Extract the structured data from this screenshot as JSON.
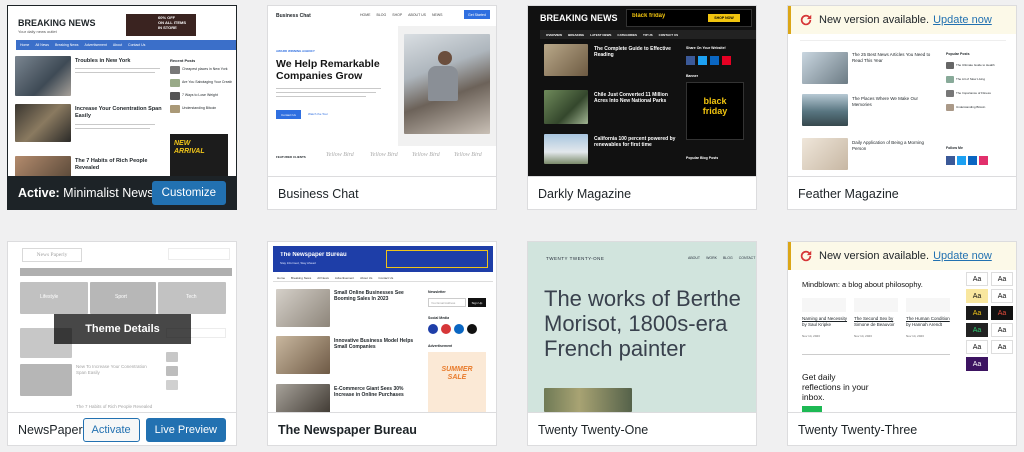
{
  "themes": [
    {
      "name": "Minimalist Newspaper",
      "active_prefix": "Active:",
      "customize_label": "Customize",
      "preview": {
        "site_title": "BREAKING NEWS",
        "tagline": "Your daily news outlet",
        "promo": "60% OFF\nON ALL ITEMS\nIN STORE",
        "nav": [
          "Home",
          "All News",
          "Breaking News",
          "Advertisement",
          "About",
          "Contact Us"
        ],
        "posts": [
          "Troubles in New York",
          "Increase Your Conentration Span Easily",
          "The 7 Habits of Rich People Revealed"
        ],
        "sidebar_title": "Recent Posts",
        "sidebar_items": [
          "Cheapest places in New York",
          "Are You Sabotaging Your Creativity?",
          "7 Ways to Lose Weight",
          "Understanding Bitcoin"
        ],
        "banner": "NEW ARRIVAL"
      }
    },
    {
      "name": "Business Chat",
      "preview": {
        "site_title": "Business Chat",
        "nav": [
          "HOME",
          "BLOG",
          "SHOP",
          "ABOUT US",
          "NEWS"
        ],
        "cta": "Get Started",
        "eyebrow": "AWARD WINNING AGENCY",
        "headline": "We Help Remarkable Companies Grow",
        "btn1": "Contact Us",
        "btn2": "Watch the Tour",
        "clients_label": "FEATURED CLIENTS",
        "clients": [
          "Yellow Bird",
          "Yellow Bird",
          "Yellow Bird",
          "Yellow Bird"
        ]
      }
    },
    {
      "name": "Darkly Magazine",
      "preview": {
        "site_title": "BREAKING NEWS",
        "promo": "black friday",
        "shop": "SHOP NOW",
        "nav": [
          "OVERVIEW",
          "BREAKING",
          "LATEST NEWS",
          "CATEGORIES",
          "TIP US",
          "CONTACT US"
        ],
        "posts": [
          "The Complete Guide to Effective Reading",
          "Chile Just Converted 11 Million Acres Into New National Parks",
          "California 100 percent powered by renewables for first time"
        ],
        "share_title": "Share On Your Website!",
        "banner_title": "Banner",
        "banner": "black friday",
        "popular_title": "Popular Blog Posts"
      }
    },
    {
      "name": "Feather Magazine",
      "notice": "New version available.",
      "update_link": "Update now",
      "preview": {
        "posts": [
          "The 25 Best News Articles You Need to Read This Year",
          "The Places Where We Make Our Memories",
          "Daily Application of Being a Morning Person"
        ],
        "popular_title": "Popular Posts",
        "popular": [
          "The Ultimate Guide to Health",
          "The Art of Slow Living",
          "The Importance of Fitness",
          "Understanding Bitcoin"
        ],
        "follow_title": "Follow Me"
      }
    },
    {
      "name": "NewsPaperly",
      "details_label": "Theme Details",
      "activate_label": "Activate",
      "live_preview_label": "Live Preview",
      "preview": {
        "logo": "News Paperly",
        "categories": [
          "Lifestyle",
          "Sport",
          "Tech"
        ],
        "post": "New To Increase Your Conentration Span Easily",
        "post2": "The 7 Habits of Rich People Revealed"
      }
    },
    {
      "name": "The Newspaper Bureau",
      "preview": {
        "site_title": "The Newspaper Bureau",
        "tagline": "Stay Informed, Stay Ahead",
        "nav": [
          "Home",
          "Breaking News",
          "All News",
          "Advertisement",
          "About Us",
          "Contact Us"
        ],
        "posts": [
          "Small Online Businesses See Booming Sales In 2023",
          "Innovative Business Model Helps Small Companies",
          "E-Commerce Giant Sees 30% Increase in Online Purchases"
        ],
        "newsletter": "Newsletter",
        "email_placeholder": "Your Email Address",
        "signup": "Sign Up",
        "social": "Social Media",
        "ad": "Advertisement",
        "sale": "SUMMER SALE"
      }
    },
    {
      "name": "Twenty Twenty-One",
      "preview": {
        "site_title": "TWENTY TWENTY-ONE",
        "nav": [
          "ABOUT",
          "WORK",
          "BLOG",
          "CONTACT"
        ],
        "headline": "The works of Berthe Morisot, 1800s-era French painter"
      }
    },
    {
      "name": "Twenty Twenty-Three",
      "notice": "New version available.",
      "update_link": "Update now",
      "preview": {
        "title": "Mindblown: a blog about philosophy.",
        "posts": [
          {
            "title": "Naming and Necessity by Saul Kripke",
            "date": "Nov 14, 2023"
          },
          {
            "title": "The Second Sex by Simone de Beauvoir",
            "date": "Nov 14, 2023"
          },
          {
            "title": "The Human Condition by Hannah Arendt",
            "date": "Nov 14, 2023"
          }
        ],
        "cta": "Get daily reflections in your inbox.",
        "swatch_label": "Aa"
      }
    }
  ]
}
